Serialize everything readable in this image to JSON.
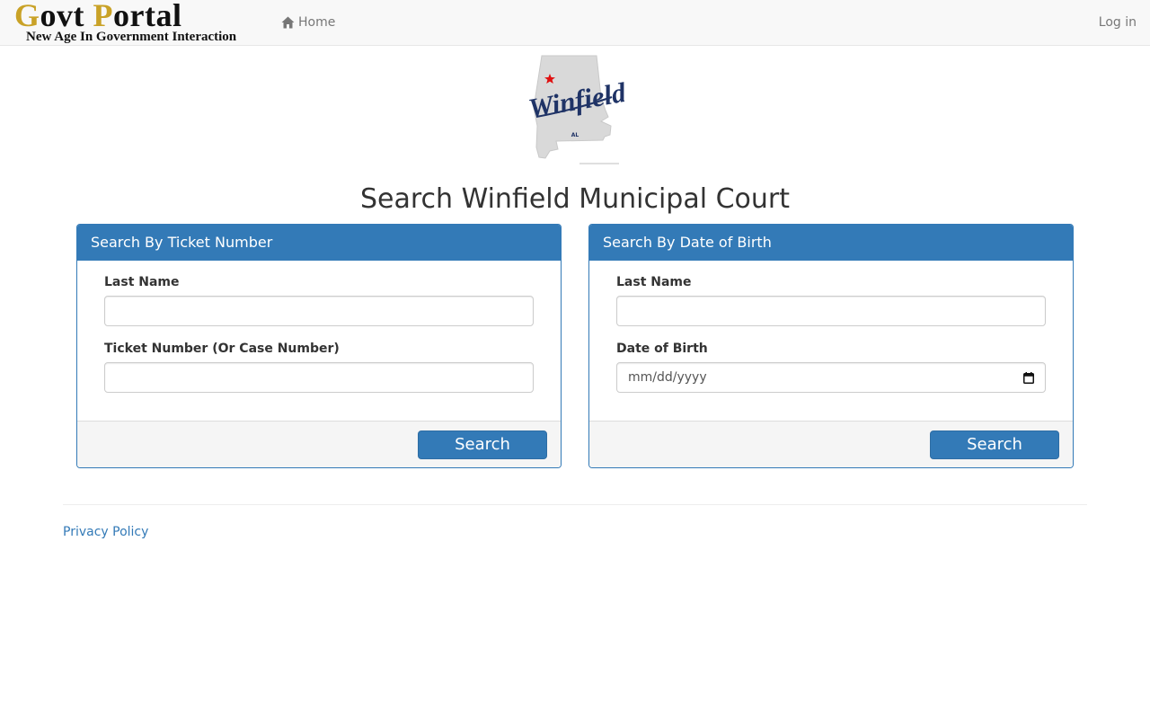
{
  "brand": {
    "title_cap1": "G",
    "title_rest1": "ovt ",
    "title_cap2": "P",
    "title_rest2": "ortal",
    "tagline": "New Age In Government Interaction"
  },
  "nav": {
    "home_label": "Home",
    "login_label": "Log in"
  },
  "logo": {
    "city": "Winfield",
    "state": "AL"
  },
  "page": {
    "title": "Search Winfield Municipal Court"
  },
  "ticket_panel": {
    "heading": "Search By Ticket Number",
    "last_name_label": "Last Name",
    "last_name_value": "",
    "ticket_label": "Ticket Number (Or Case Number)",
    "ticket_value": "",
    "search_label": "Search"
  },
  "dob_panel": {
    "heading": "Search By Date of Birth",
    "last_name_label": "Last Name",
    "last_name_value": "",
    "dob_label": "Date of Birth",
    "dob_placeholder": "mm/dd/yyyy",
    "search_label": "Search"
  },
  "footer": {
    "privacy_label": "Privacy Policy"
  },
  "colors": {
    "primary": "#337ab7",
    "brand_gold": "#c9a227",
    "navbar_bg": "#f8f8f8",
    "logo_navy": "#1f3366",
    "star_red": "#e01010"
  },
  "icons": {
    "home": "home-icon",
    "calendar": "calendar-icon",
    "star": "star-icon"
  }
}
